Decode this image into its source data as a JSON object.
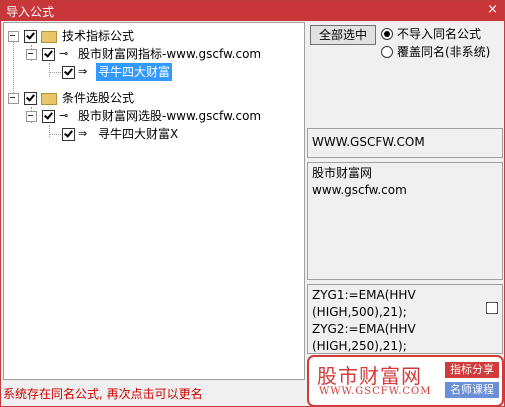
{
  "window": {
    "title": "导入公式",
    "close_glyph": "×"
  },
  "tree": {
    "groups": [
      {
        "label": "技术指标公式",
        "item_label": "股市财富网指标-www.gscfw.com",
        "leaf_label": "寻牛四大财富"
      },
      {
        "label": "条件选股公式",
        "item_label": "股市财富网选股-www.gscfw.com",
        "leaf_label": "寻牛四大财富X"
      }
    ]
  },
  "controls": {
    "select_all_label": "全部选中",
    "option_skip_label": "不导入同名公式",
    "option_overwrite_label": "覆盖同名(非系统)"
  },
  "info": {
    "site_caption": "WWW.GSCFW.COM",
    "description_line1": "股市财富网",
    "description_line2": "www.gscfw.com",
    "code_line1": "ZYG1:=EMA(HHV",
    "code_line2": "(HIGH,500),21);",
    "code_line3": "ZYG2:=EMA(HHV",
    "code_line4": "(HIGH,250),21);"
  },
  "status": {
    "message": "系统存在同名公式, 再次点击可以更名"
  },
  "logo": {
    "name": "股市财富网",
    "url": "WWW.GSCFW.COM",
    "tag1": "指标分享",
    "tag2": "名师课程"
  },
  "colors": {
    "title_bar": "#c9363a",
    "selection": "#3399ff",
    "status_text": "#cc0000",
    "brand": "#d23b3b"
  }
}
